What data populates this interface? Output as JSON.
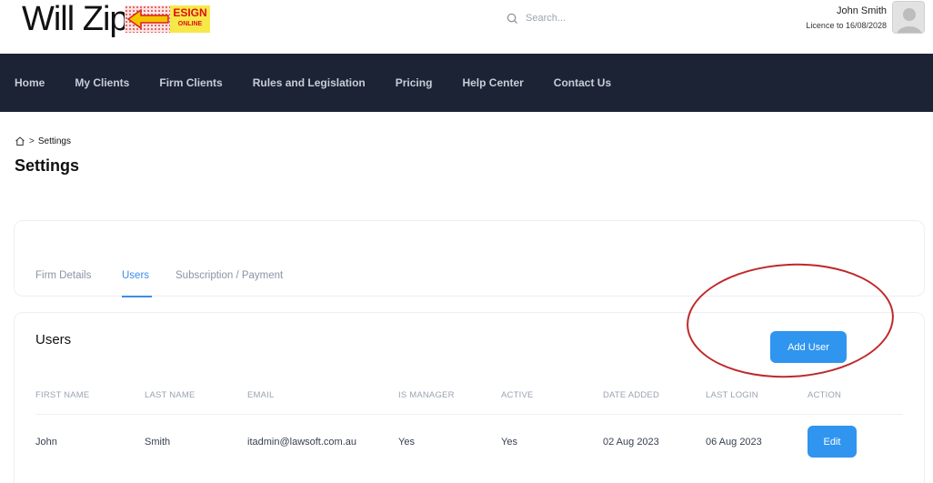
{
  "header": {
    "logo_text": "Will Zip",
    "logo_badge_line1": "ESIGN",
    "logo_badge_line2": "ONLINE",
    "search_placeholder": "Search...",
    "user_name": "John Smith",
    "licence": "Licence to 16/08/2028"
  },
  "nav": {
    "items": [
      "Home",
      "My Clients",
      "Firm Clients",
      "Rules and Legislation",
      "Pricing",
      "Help Center",
      "Contact Us"
    ]
  },
  "breadcrumb": {
    "current": "Settings",
    "separator": ">"
  },
  "page": {
    "title": "Settings"
  },
  "tabs": [
    {
      "label": "Firm Details",
      "active": false
    },
    {
      "label": "Users",
      "active": true
    },
    {
      "label": "Subscription / Payment",
      "active": false
    }
  ],
  "users": {
    "title": "Users",
    "add_button": "Add User",
    "columns": [
      "FIRST NAME",
      "LAST NAME",
      "EMAIL",
      "IS MANAGER",
      "ACTIVE",
      "DATE ADDED",
      "LAST LOGIN",
      "ACTION"
    ],
    "rows": [
      {
        "first_name": "John",
        "last_name": "Smith",
        "email": "itadmin@lawsoft.com.au",
        "is_manager": "Yes",
        "active": "Yes",
        "date_added": "02 Aug 2023",
        "last_login": "06 Aug 2023",
        "action": "Edit"
      }
    ]
  },
  "colors": {
    "nav_bg": "#1b2334",
    "accent": "#2f95ee",
    "annotation": "#c0282a"
  }
}
